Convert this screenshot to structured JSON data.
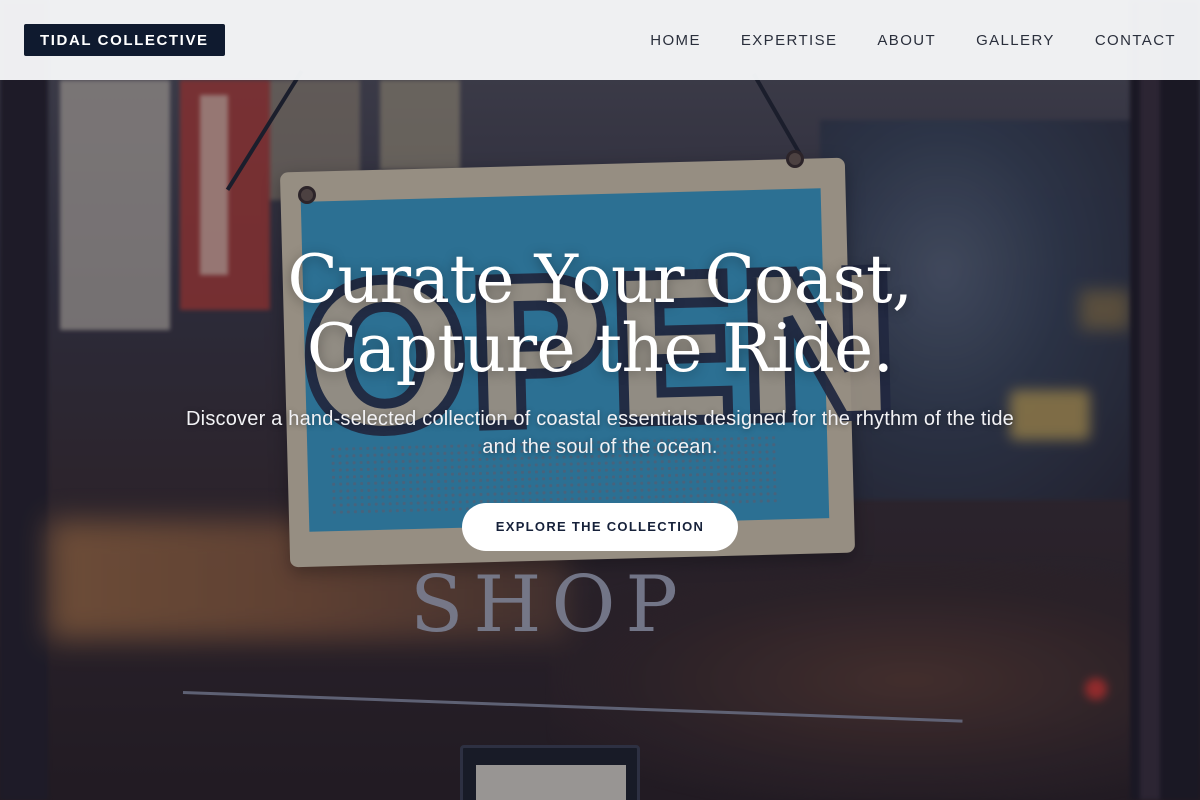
{
  "brand": {
    "name": "TIDAL COLLECTIVE"
  },
  "nav": {
    "items": [
      {
        "label": "HOME"
      },
      {
        "label": "EXPERTISE"
      },
      {
        "label": "ABOUT"
      },
      {
        "label": "GALLERY"
      },
      {
        "label": "CONTACT"
      }
    ]
  },
  "hero": {
    "headline_line1": "Curate Your Coast,",
    "headline_line2": "Capture the Ride.",
    "subtext": "Discover a hand-selected collection of coastal essentials designed for the rhythm of the tide and the soul of the ocean.",
    "cta_label": "EXPLORE THE COLLECTION",
    "background_sign_text": "OPEN",
    "background_glass_text": "SHOP"
  },
  "colors": {
    "brand_bg": "#0f1a2f",
    "nav_text": "#2a2f3c",
    "header_bg": "#f5f6f8",
    "cta_bg": "#ffffff",
    "cta_text": "#16213a",
    "sign_blue": "#3aa9d8"
  }
}
